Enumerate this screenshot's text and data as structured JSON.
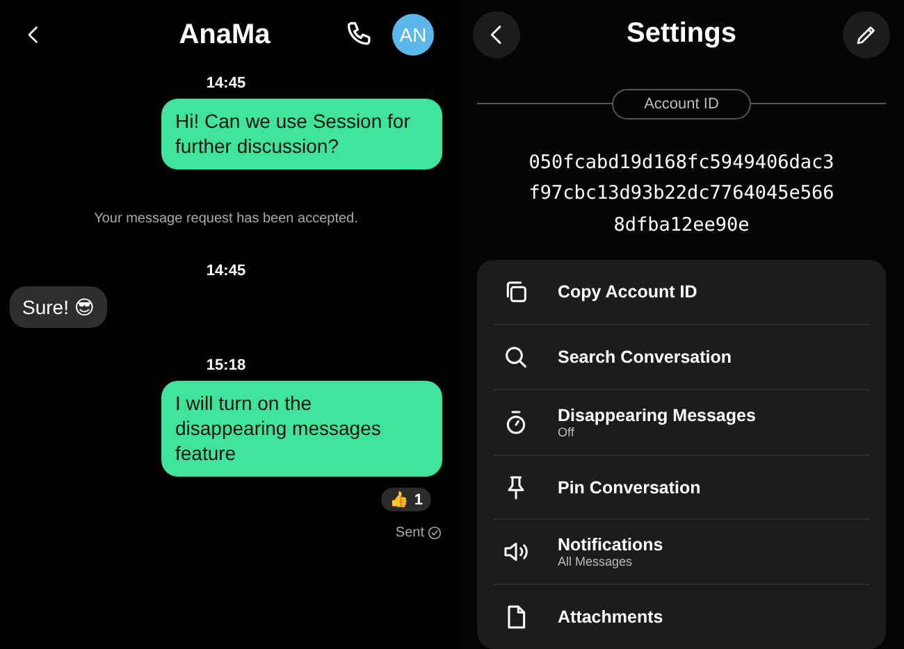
{
  "chat": {
    "title": "AnaMa",
    "avatar": "AN",
    "messages": [
      {
        "kind": "time",
        "text": "14:45"
      },
      {
        "kind": "outgoing",
        "text": "Hi! Can we use Session for further discussion?"
      },
      {
        "kind": "notice",
        "text": "Your message request has been accepted."
      },
      {
        "kind": "time",
        "text": "14:45"
      },
      {
        "kind": "incoming",
        "text": "Sure! 😎"
      },
      {
        "kind": "time",
        "text": "15:18"
      },
      {
        "kind": "outgoing",
        "text": "I will turn on the disappearing messages feature",
        "reaction": {
          "emoji": "👍",
          "count": "1"
        },
        "status": "Sent"
      }
    ]
  },
  "settings": {
    "title": "Settings",
    "id_label": "Account ID",
    "account_id": [
      "050fcabd19d168fc5949406dac3",
      "f97cbc13d93b22dc7764045e566",
      "8dfba12ee90e"
    ],
    "items": [
      {
        "kind": "copy",
        "label": "Copy Account ID"
      },
      {
        "kind": "search",
        "label": "Search Conversation"
      },
      {
        "kind": "timer",
        "label": "Disappearing Messages",
        "sub": "Off"
      },
      {
        "kind": "pin",
        "label": "Pin Conversation"
      },
      {
        "kind": "speaker",
        "label": "Notifications",
        "sub": "All Messages"
      },
      {
        "kind": "file",
        "label": "Attachments"
      }
    ]
  }
}
